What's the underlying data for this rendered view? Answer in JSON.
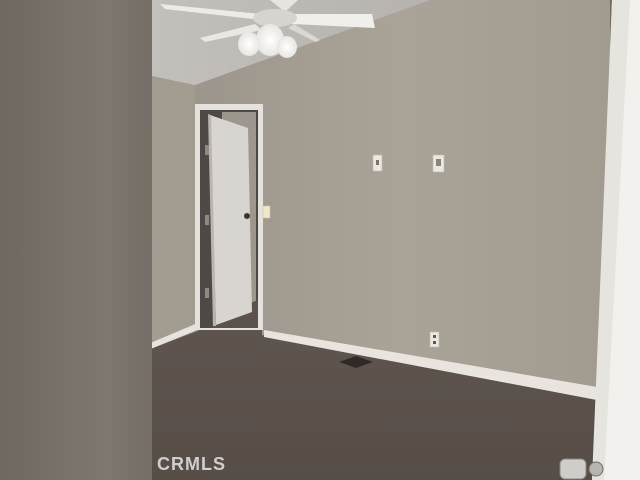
{
  "photo": {
    "watermark": "CRMLS",
    "colors": {
      "wall": "#a8a196",
      "wall_shadow": "#8d877d",
      "ceiling": "#c9c6c2",
      "carpet": "#5c524c",
      "baseboard": "#ece8e1",
      "door": "#d9d6d1",
      "foreground_panel": "#7d776f",
      "door_edge": "#f3f2ef"
    },
    "objects": [
      "ceiling-fan",
      "open-door",
      "light-switch",
      "wall-plate",
      "wall-outlet",
      "floor-vent",
      "door-knob"
    ]
  }
}
